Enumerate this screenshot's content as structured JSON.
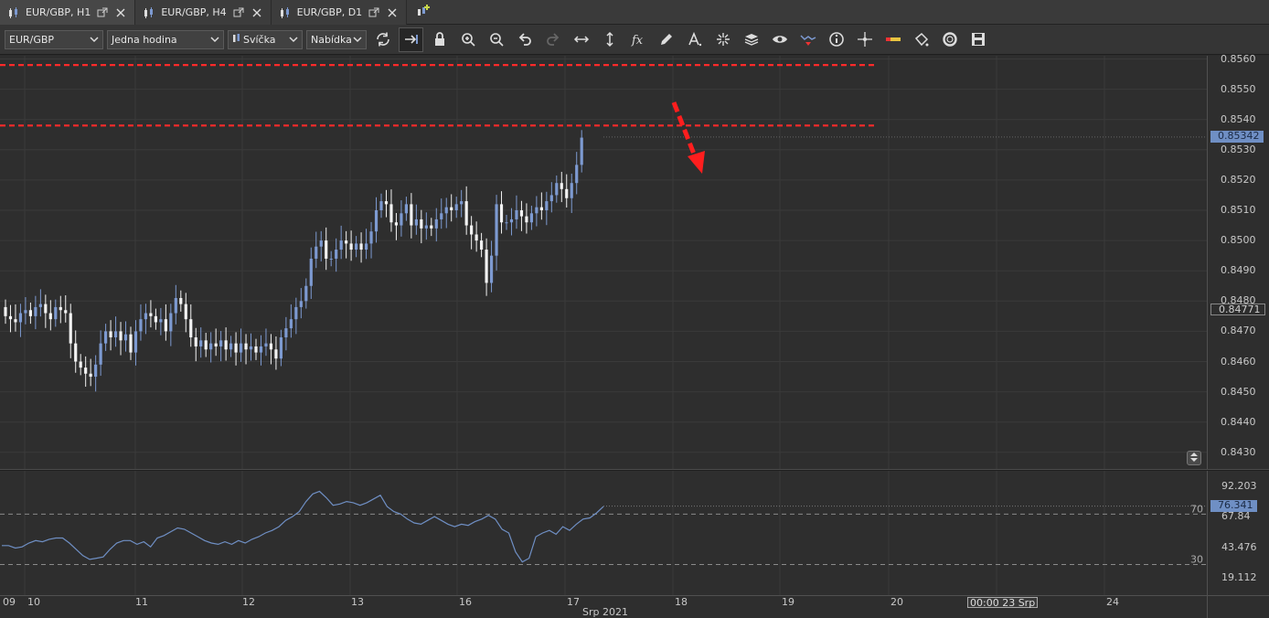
{
  "tabs": [
    {
      "label": "EUR/GBP, H1",
      "active": true
    },
    {
      "label": "EUR/GBP, H4",
      "active": false
    },
    {
      "label": "EUR/GBP, D1",
      "active": false
    }
  ],
  "toolbar": {
    "instrument": "EUR/GBP",
    "period": "Jedna hodina",
    "chart_type": "Svíčka",
    "price_side": "Nabídka"
  },
  "colors": {
    "bull": "#7d9ad1",
    "bear": "#f2f2f2",
    "resistance": "#ff2a2a",
    "arrow": "#ff1e1e",
    "rsi": "#6f8fc4"
  },
  "price_axis": {
    "ticks": [
      "0.8560",
      "0.8550",
      "0.8540",
      "0.8530",
      "0.8520",
      "0.8510",
      "0.8500",
      "0.8490",
      "0.8480",
      "0.8470",
      "0.8460",
      "0.8450",
      "0.8440",
      "0.8430"
    ],
    "current_price": "0.85342",
    "marker_price": "0.84771"
  },
  "rsi_axis": {
    "ticks": [
      "92.203",
      "67.84",
      "43.476",
      "19.112"
    ],
    "current_value": "76.341",
    "upper_level": "70",
    "lower_level": "30"
  },
  "time_axis": {
    "labels": [
      "09",
      "10",
      "11",
      "12",
      "13",
      "16",
      "17",
      "18",
      "19",
      "20",
      "24"
    ],
    "period_label": "Srp 2021",
    "cursor_time": "00:00 23 Srp"
  },
  "chart_data": {
    "type": "candlestick",
    "instrument": "EUR/GBP",
    "timeframe": "H1",
    "ylim": [
      0.8425,
      0.8562
    ],
    "resistance_levels": [
      0.8558,
      0.8538
    ],
    "closes": [
      0.8475,
      0.8474,
      0.8473,
      0.8476,
      0.8477,
      0.8475,
      0.8478,
      0.8479,
      0.8476,
      0.8474,
      0.8478,
      0.8477,
      0.8476,
      0.8466,
      0.846,
      0.8458,
      0.8456,
      0.8455,
      0.8459,
      0.8466,
      0.847,
      0.8468,
      0.847,
      0.8467,
      0.8469,
      0.8463,
      0.847,
      0.8474,
      0.8476,
      0.8475,
      0.8473,
      0.8474,
      0.847,
      0.8476,
      0.8481,
      0.8479,
      0.8474,
      0.8468,
      0.8465,
      0.8467,
      0.8464,
      0.8466,
      0.8465,
      0.8467,
      0.8464,
      0.8466,
      0.8463,
      0.8466,
      0.8464,
      0.8465,
      0.8463,
      0.8465,
      0.8466,
      0.8464,
      0.8461,
      0.8468,
      0.8471,
      0.8474,
      0.8478,
      0.848,
      0.8485,
      0.8494,
      0.8498,
      0.85,
      0.8494,
      0.8494,
      0.8497,
      0.85,
      0.8499,
      0.8497,
      0.8499,
      0.8497,
      0.8499,
      0.8503,
      0.851,
      0.8513,
      0.8512,
      0.8506,
      0.8505,
      0.8509,
      0.8512,
      0.8505,
      0.8507,
      0.8504,
      0.8505,
      0.8504,
      0.8507,
      0.8509,
      0.8511,
      0.851,
      0.8512,
      0.8513,
      0.8505,
      0.8502,
      0.85,
      0.8497,
      0.8486,
      0.8495,
      0.8512,
      0.8506,
      0.8506,
      0.8507,
      0.851,
      0.8508,
      0.8506,
      0.8509,
      0.8511,
      0.851,
      0.8513,
      0.8515,
      0.8519,
      0.8517,
      0.8514,
      0.8519,
      0.8525,
      0.8534
    ],
    "rsi": {
      "values": [
        45,
        45,
        43,
        44,
        47,
        49,
        48,
        50,
        51,
        51,
        47,
        42,
        37,
        34,
        35,
        36,
        42,
        47,
        49,
        49,
        46,
        48,
        44,
        51,
        53,
        56,
        59,
        58,
        55,
        52,
        49,
        47,
        46,
        48,
        46,
        49,
        47,
        50,
        52,
        55,
        57,
        60,
        65,
        68,
        72,
        80,
        86,
        88,
        83,
        77,
        78,
        80,
        79,
        77,
        79,
        82,
        85,
        76,
        72,
        70,
        66,
        63,
        62,
        65,
        68,
        65,
        62,
        60,
        62,
        61,
        64,
        66,
        69,
        66,
        58,
        55,
        40,
        32,
        35,
        52,
        55,
        57,
        54,
        60,
        57,
        62,
        66,
        67,
        71,
        76
      ],
      "levels": [
        70,
        30
      ],
      "ylim": [
        10,
        100
      ]
    }
  }
}
